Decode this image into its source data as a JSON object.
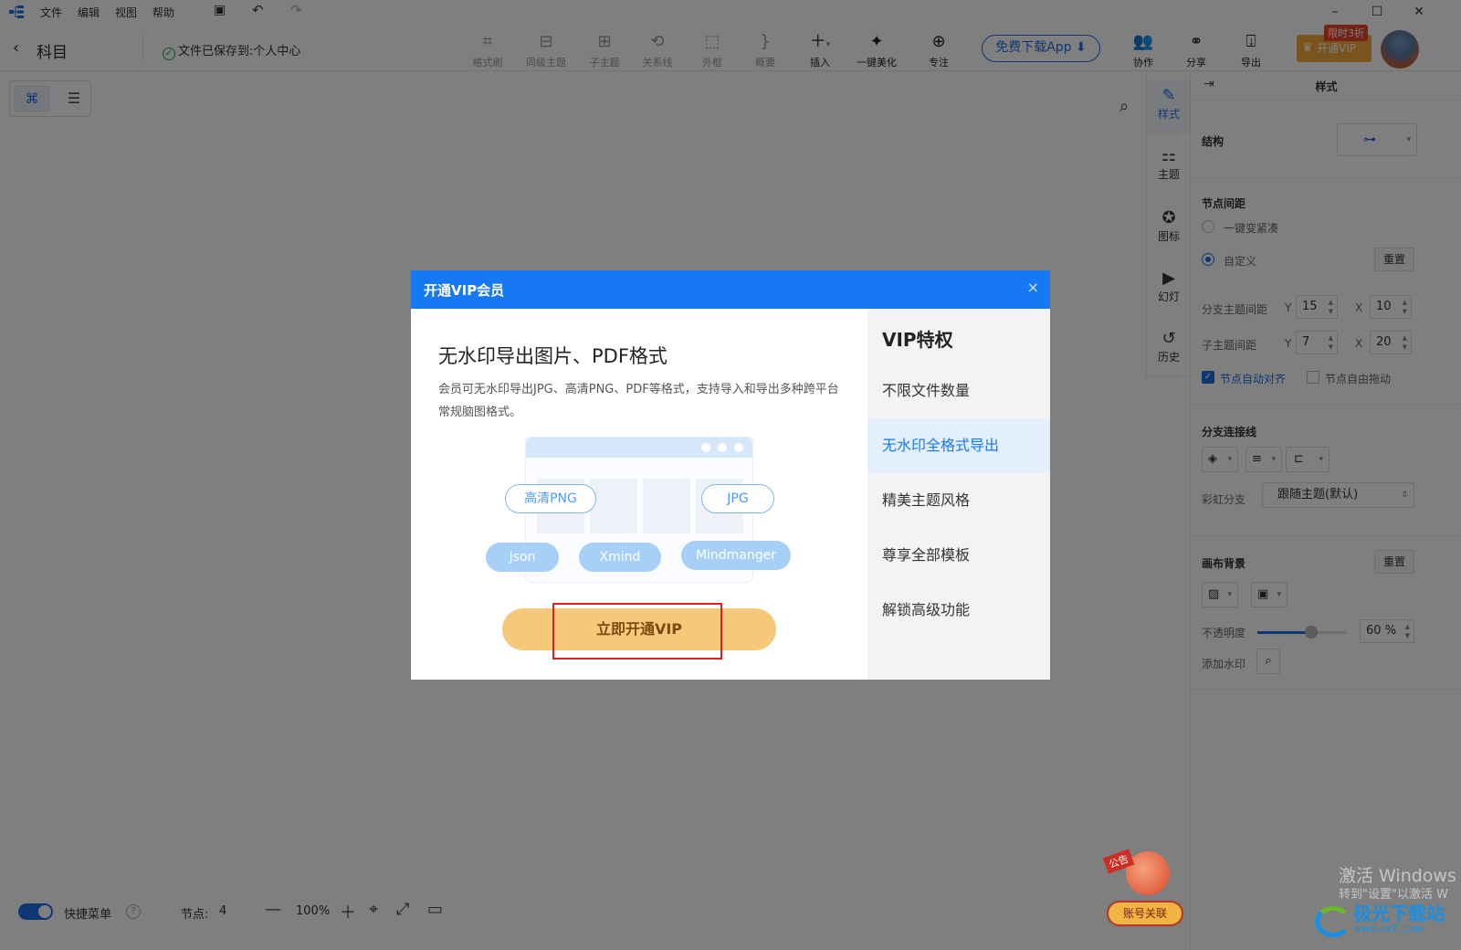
{
  "menu": {
    "items": [
      "文件",
      "编辑",
      "视图",
      "帮助"
    ]
  },
  "toolbar": {
    "back_glyph": "‹",
    "doc_title": "科目",
    "saved_text": "文件已保存到:",
    "saved_location": "个人中心",
    "tools": [
      {
        "label": "格式刷",
        "icon": "format-brush-icon"
      },
      {
        "label": "同级主题",
        "icon": "sibling-topic-icon"
      },
      {
        "label": "子主题",
        "icon": "child-topic-icon"
      },
      {
        "label": "关系线",
        "icon": "relation-line-icon"
      },
      {
        "label": "外框",
        "icon": "boundary-icon"
      },
      {
        "label": "概要",
        "icon": "summary-icon"
      },
      {
        "label": "插入",
        "icon": "plus-icon"
      },
      {
        "label": "一键美化",
        "icon": "magic-wand-icon"
      },
      {
        "label": "专注",
        "icon": "focus-icon"
      }
    ],
    "download_app": "免费下载App",
    "right_tools": [
      {
        "label": "协作",
        "icon": "collaborate-icon"
      },
      {
        "label": "分享",
        "icon": "share-icon"
      },
      {
        "label": "导出",
        "icon": "export-icon"
      }
    ],
    "vip_badge": "限时3折",
    "vip_button": "开通VIP"
  },
  "rail": {
    "items": [
      {
        "label": "样式",
        "icon": "style-icon"
      },
      {
        "label": "主题",
        "icon": "theme-icon"
      },
      {
        "label": "图标",
        "icon": "icon-icon"
      },
      {
        "label": "幻灯",
        "icon": "slides-icon"
      },
      {
        "label": "历史",
        "icon": "history-icon"
      }
    ]
  },
  "panel": {
    "title": "样式",
    "structure_label": "结构",
    "spacing_label": "节点间距",
    "compact_option": "一键变紧凑",
    "custom_option": "自定义",
    "reset": "重置",
    "branch_spacing_label": "分支主题间距",
    "sub_spacing_label": "子主题间距",
    "y_label": "Y",
    "x_label": "X",
    "branch_y": "15",
    "branch_x": "10",
    "sub_y": "7",
    "sub_x": "20",
    "auto_align": "节点自动对齐",
    "free_drag": "节点自由拖动",
    "branch_line_label": "分支连接线",
    "rainbow_label": "彩虹分支",
    "rainbow_value": "跟随主题(默认)",
    "canvas_bg_label": "画布背景",
    "opacity_label": "不透明度",
    "opacity_value": "60",
    "opacity_unit": "%",
    "opacity_level": 0.6,
    "watermark_label": "添加水印"
  },
  "bottom": {
    "quick_menu": "快捷菜单",
    "help": "?",
    "nodes_label": "节点:",
    "nodes_count": "4",
    "zoom": "100%"
  },
  "modal": {
    "title": "开通VIP会员",
    "close": "×",
    "heading": "无水印导出图片、PDF格式",
    "description": "会员可无水印导出JPG、高清PNG、PDF等格式，支持导入和导出多种跨平台常规脑图格式。",
    "formats_outline": [
      "高清PNG",
      "JPG"
    ],
    "formats_filled": [
      "Json",
      "Xmind",
      "Mindmanger"
    ],
    "cta": "立即开通VIP",
    "side_title": "VIP特权",
    "features": [
      "不限文件数量",
      "无水印全格式导出",
      "精美主题风格",
      "尊享全部模板",
      "解锁高级功能"
    ],
    "selected_feature": 1
  },
  "notice": {
    "tag": "公告",
    "button": "账号关联"
  },
  "windows": {
    "activate_line1": "激活 Windows",
    "activate_line2": "转到\"设置\"以激活 W"
  },
  "watermark": {
    "brand": "极光下载站",
    "url": "www.xz7.com"
  },
  "colors": {
    "accent": "#1778f4",
    "vip": "#f2a93b",
    "cta": "#f6c87a",
    "highlight": "#e21e1e"
  }
}
